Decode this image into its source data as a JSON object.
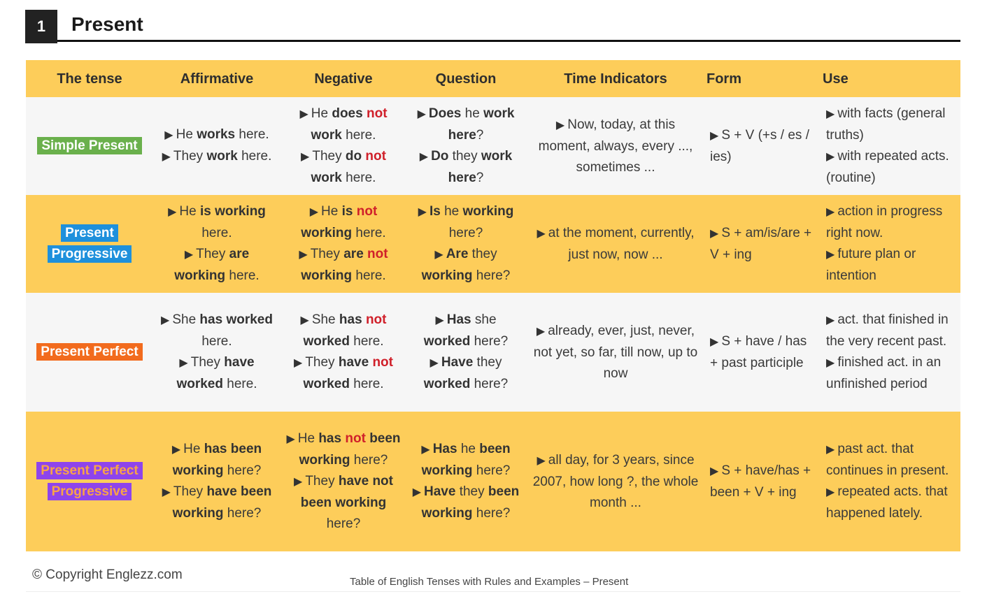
{
  "heading": {
    "number": "1",
    "title": "Present"
  },
  "columns": [
    "The tense",
    "Affirmative",
    "Negative",
    "Question",
    "Time Indicators",
    "Form",
    "Use"
  ],
  "rows": [
    {
      "tense": "Simple Present",
      "tense_color": "#6ab04c",
      "affirmative": [
        [
          {
            "t": "He "
          },
          {
            "t": "works",
            "s": "b"
          },
          {
            "t": " here."
          }
        ],
        [
          {
            "t": "They "
          },
          {
            "t": "work",
            "s": "b"
          },
          {
            "t": " here."
          }
        ]
      ],
      "negative": [
        [
          {
            "t": "He "
          },
          {
            "t": "does",
            "s": "b"
          },
          {
            "t": " "
          },
          {
            "t": "not",
            "s": "neg"
          },
          {
            "t": " "
          },
          {
            "t": "work",
            "s": "b"
          },
          {
            "t": " here."
          }
        ],
        [
          {
            "t": "They "
          },
          {
            "t": "do",
            "s": "b"
          },
          {
            "t": " "
          },
          {
            "t": "not",
            "s": "neg"
          },
          {
            "t": " "
          },
          {
            "t": "work",
            "s": "b"
          },
          {
            "t": " here."
          }
        ]
      ],
      "question": [
        [
          {
            "t": "Does",
            "s": "b"
          },
          {
            "t": " he "
          },
          {
            "t": "work here",
            "s": "b"
          },
          {
            "t": "?"
          }
        ],
        [
          {
            "t": "Do",
            "s": "b"
          },
          {
            "t": " they "
          },
          {
            "t": "work here",
            "s": "b"
          },
          {
            "t": "?"
          }
        ]
      ],
      "time_indicators": "Now, today, at this moment, always, every ..., sometimes ...",
      "form": "S + V (+s / es / ies)",
      "use": [
        "with facts (general truths)",
        "with repeated acts. (routine)"
      ]
    },
    {
      "tense": "Present Progressive",
      "tense_color": "#1e90dc",
      "affirmative": [
        [
          {
            "t": "He "
          },
          {
            "t": "is working",
            "s": "b"
          },
          {
            "t": " here."
          }
        ],
        [
          {
            "t": "They "
          },
          {
            "t": "are",
            "s": "b"
          },
          {
            "t": " "
          },
          {
            "t": "working",
            "s": "b"
          },
          {
            "t": " here."
          }
        ]
      ],
      "negative": [
        [
          {
            "t": "He "
          },
          {
            "t": "is",
            "s": "b"
          },
          {
            "t": " "
          },
          {
            "t": "not",
            "s": "neg"
          },
          {
            "t": " "
          },
          {
            "t": "working",
            "s": "b"
          },
          {
            "t": " here."
          }
        ],
        [
          {
            "t": "They "
          },
          {
            "t": "are",
            "s": "b"
          },
          {
            "t": " "
          },
          {
            "t": "not",
            "s": "neg"
          },
          {
            "t": " "
          },
          {
            "t": "working",
            "s": "b"
          },
          {
            "t": " here."
          }
        ]
      ],
      "question": [
        [
          {
            "t": "Is",
            "s": "b"
          },
          {
            "t": " he "
          },
          {
            "t": "working",
            "s": "b"
          },
          {
            "t": " here?"
          }
        ],
        [
          {
            "t": "Are",
            "s": "b"
          },
          {
            "t": " they "
          },
          {
            "t": "working",
            "s": "b"
          },
          {
            "t": " here?"
          }
        ]
      ],
      "time_indicators": "at the moment, currently, just now, now ...",
      "form": "S + am/is/are + V + ing",
      "use": [
        "action in progress right now.",
        "future plan or intention"
      ]
    },
    {
      "tense": "Present Perfect",
      "tense_color": "#f26b1d",
      "affirmative": [
        [
          {
            "t": "She "
          },
          {
            "t": "has",
            "s": "b"
          },
          {
            "t": " "
          },
          {
            "t": "worked",
            "s": "b"
          },
          {
            "t": " here."
          }
        ],
        [
          {
            "t": "They "
          },
          {
            "t": "have",
            "s": "b"
          },
          {
            "t": " "
          },
          {
            "t": "worked",
            "s": "b"
          },
          {
            "t": " here."
          }
        ]
      ],
      "negative": [
        [
          {
            "t": "She "
          },
          {
            "t": "has",
            "s": "b"
          },
          {
            "t": " "
          },
          {
            "t": "not",
            "s": "neg"
          },
          {
            "t": " "
          },
          {
            "t": "worked",
            "s": "b"
          },
          {
            "t": " here."
          }
        ],
        [
          {
            "t": "They "
          },
          {
            "t": "have",
            "s": "b"
          },
          {
            "t": " "
          },
          {
            "t": "not",
            "s": "neg"
          },
          {
            "t": " "
          },
          {
            "t": "worked",
            "s": "b"
          },
          {
            "t": " here."
          }
        ]
      ],
      "question": [
        [
          {
            "t": "Has",
            "s": "b"
          },
          {
            "t": " she "
          },
          {
            "t": "worked",
            "s": "b"
          },
          {
            "t": " here?"
          }
        ],
        [
          {
            "t": "Have",
            "s": "b"
          },
          {
            "t": " they "
          },
          {
            "t": "worked",
            "s": "b"
          },
          {
            "t": " here?"
          }
        ]
      ],
      "time_indicators": "already, ever, just, never, not yet, so far, till now, up to now",
      "form": "S + have / has + past participle",
      "use": [
        "act. that finished in the very recent past.",
        "finished act. in an unfinished period"
      ]
    },
    {
      "tense": "Present Perfect Progressive",
      "tense_color": "#8e44ec",
      "affirmative": [
        [
          {
            "t": "He "
          },
          {
            "t": "has been working",
            "s": "b"
          },
          {
            "t": " here?"
          }
        ],
        [
          {
            "t": "They "
          },
          {
            "t": "have been working",
            "s": "b"
          },
          {
            "t": " here?"
          }
        ]
      ],
      "negative": [
        [
          {
            "t": "He "
          },
          {
            "t": "has",
            "s": "b"
          },
          {
            "t": " "
          },
          {
            "t": "not",
            "s": "neg"
          },
          {
            "t": " "
          },
          {
            "t": "been working",
            "s": "b"
          },
          {
            "t": " here?"
          }
        ],
        [
          {
            "t": "They "
          },
          {
            "t": "have not been working",
            "s": "b"
          },
          {
            "t": " here?"
          }
        ]
      ],
      "question": [
        [
          {
            "t": "Has",
            "s": "b"
          },
          {
            "t": " he "
          },
          {
            "t": "been working",
            "s": "b"
          },
          {
            "t": " here?"
          }
        ],
        [
          {
            "t": "Have",
            "s": "b"
          },
          {
            "t": " they "
          },
          {
            "t": "been working",
            "s": "b"
          },
          {
            "t": " here?"
          }
        ]
      ],
      "time_indicators": "all day, for 3 years, since 2007, how long ?, the whole month ...",
      "form": "S + have/has + been + V + ing",
      "use": [
        "past act. that continues in present.",
        "repeated acts. that happened lately."
      ]
    }
  ],
  "footer": {
    "copyright": "© Copyright Englezz.com",
    "caption": "Table of English Tenses with Rules and Examples – Present"
  },
  "arrow_glyph": "▶"
}
